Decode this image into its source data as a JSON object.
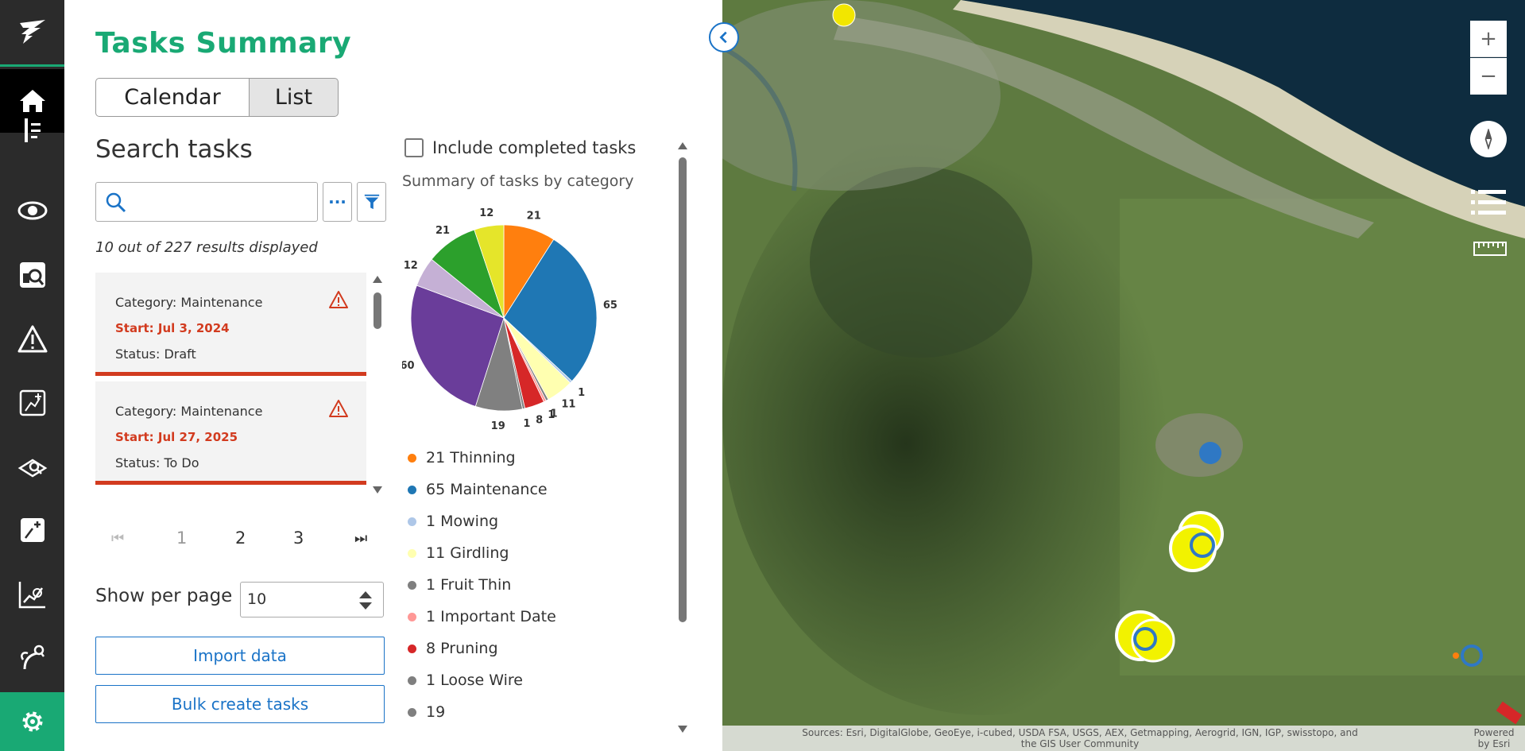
{
  "panel": {
    "title": "Tasks Summary",
    "view_toggle": {
      "calendar": "Calendar",
      "list": "List",
      "active": "List"
    },
    "search_heading": "Search tasks",
    "search_placeholder": "",
    "more_label": "···",
    "results_text": "10 out of 227 results displayed",
    "tasks": [
      {
        "category": "Category: Maintenance",
        "start": "Start: Jul 3, 2024",
        "status": "Status: Draft"
      },
      {
        "category": "Category: Maintenance",
        "start": "Start: Jul 27, 2025",
        "status": "Status: To Do"
      }
    ],
    "pager": {
      "first": "⏮",
      "pages": [
        "1",
        "2",
        "3"
      ],
      "last": "⏭",
      "current": "1"
    },
    "per_page_label": "Show per page",
    "per_page_value": "10",
    "import_button": "Import data",
    "bulk_button": "Bulk create tasks",
    "include_completed": "Include completed tasks",
    "include_checked": false
  },
  "chart_data": {
    "type": "pie",
    "title": "Summary of tasks by category",
    "series": [
      {
        "name": "Thinning",
        "value": 21,
        "color": "#ff7f0e"
      },
      {
        "name": "Maintenance",
        "value": 65,
        "color": "#1f77b4"
      },
      {
        "name": "Mowing",
        "value": 1,
        "color": "#aec7e8"
      },
      {
        "name": "Girdling",
        "value": 11,
        "color": "#ffffb0"
      },
      {
        "name": "Fruit Thin",
        "value": 1,
        "color": "#7f7f7f"
      },
      {
        "name": "Important Date",
        "value": 1,
        "color": "#ff9896"
      },
      {
        "name": "Pruning",
        "value": 8,
        "color": "#d62728"
      },
      {
        "name": "Loose Wire",
        "value": 1,
        "color": "#7f7f7f"
      },
      {
        "name": "",
        "value": 19,
        "color": "#808080"
      },
      {
        "name": "",
        "value": 60,
        "color": "#6a3d9a"
      },
      {
        "name": "",
        "value": 12,
        "color": "#c5b0d5"
      },
      {
        "name": "",
        "value": 21,
        "color": "#2ca02c"
      },
      {
        "name": "",
        "value": 12,
        "color": "#e5e52a"
      }
    ],
    "legend": [
      {
        "label": "21 Thinning",
        "color": "#ff7f0e"
      },
      {
        "label": "65 Maintenance",
        "color": "#1f77b4"
      },
      {
        "label": "1 Mowing",
        "color": "#aec7e8"
      },
      {
        "label": "11 Girdling",
        "color": "#ffffb0"
      },
      {
        "label": "1 Fruit Thin",
        "color": "#7f7f7f"
      },
      {
        "label": "1 Important Date",
        "color": "#ff9896"
      },
      {
        "label": "8 Pruning",
        "color": "#d62728"
      },
      {
        "label": "1 Loose Wire",
        "color": "#7f7f7f"
      },
      {
        "label": "19",
        "color": "#7f7f7f"
      }
    ]
  },
  "map": {
    "zoom_in": "+",
    "zoom_out": "−",
    "attribution": "Sources: Esri, DigitalGlobe, GeoEye, i-cubed, USDA FSA, USGS, AEX, Getmapping, Aerogrid, IGN, IGP, swisstopo, and the GIS User Community",
    "powered_by": "Powered by Esri"
  },
  "colors": {
    "brand": "#19a974",
    "accent": "#1a73c7",
    "alert": "#d23b1f",
    "rail": "#2b2b2b"
  }
}
